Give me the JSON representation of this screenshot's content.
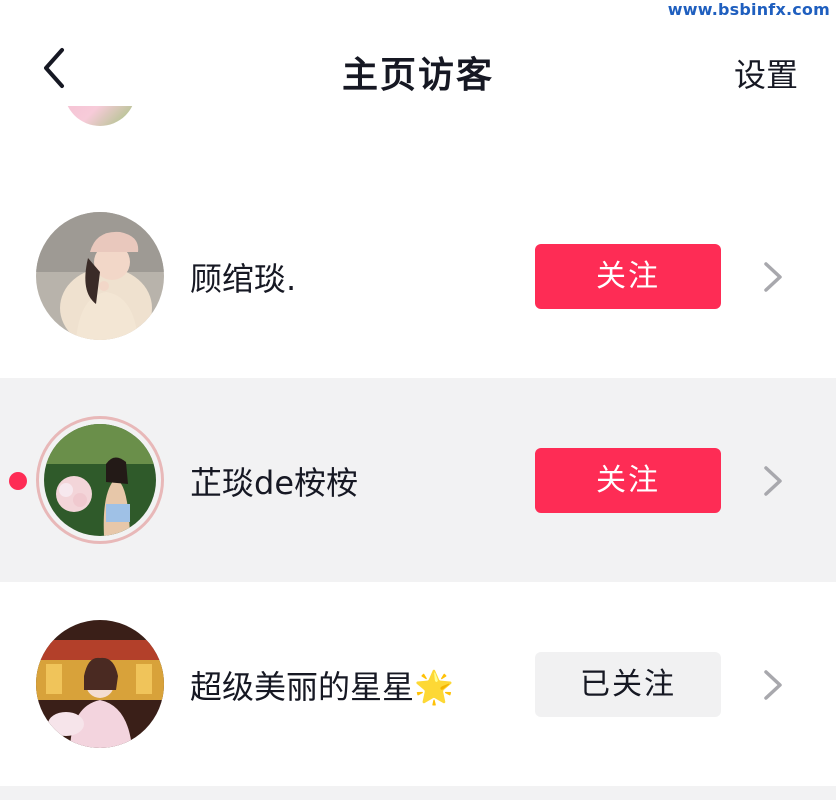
{
  "watermark": "www.bsbinfx.com",
  "header": {
    "title": "主页访客",
    "settings_label": "设置",
    "back_icon": "chevron-left-icon"
  },
  "visitors": [
    {
      "name": "顾绾琰.",
      "button_label": "关注",
      "button_state": "follow",
      "highlighted": false,
      "unread_dot": false,
      "avatar_icon": "avatar"
    },
    {
      "name": "芷琰de桉桉",
      "button_label": "关注",
      "button_state": "follow",
      "highlighted": true,
      "unread_dot": true,
      "avatar_icon": "avatar"
    },
    {
      "name": "超级美丽的星星🌟",
      "button_label": "已关注",
      "button_state": "following",
      "highlighted": false,
      "unread_dot": false,
      "avatar_icon": "avatar"
    }
  ],
  "colors": {
    "accent": "#fe2c55",
    "highlight_bg": "#f2f2f3",
    "following_bg": "#f1f1f2",
    "text": "#161823"
  }
}
